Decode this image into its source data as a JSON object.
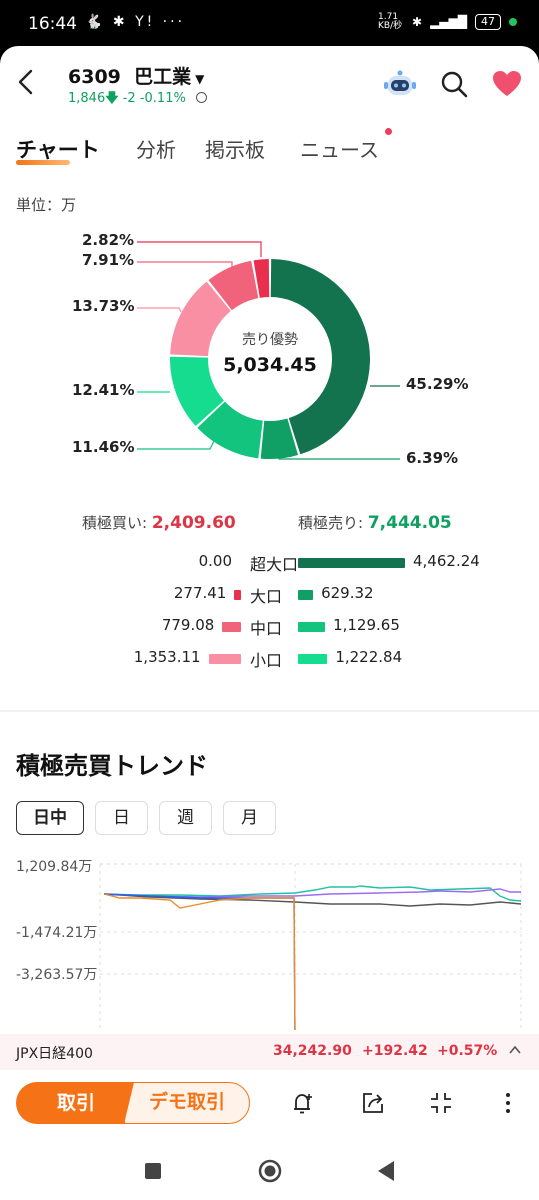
{
  "status": {
    "time": "16:44",
    "left_icons": "🐇 ✱ Y! ···",
    "speed": "1.71 KB/秒",
    "battery": "47"
  },
  "header": {
    "code": "6309",
    "name": "巴工業",
    "price": "1,846",
    "change": "-2 -0.11%"
  },
  "tabs": [
    "チャート",
    "分析",
    "掲示板",
    "ニュース"
  ],
  "unit_label": "単位：万",
  "donut": {
    "center_label": "売り優勢",
    "center_value": "5,034.45",
    "labels": {
      "p1": "2.82%",
      "p2": "7.91%",
      "p3": "13.73%",
      "p4": "12.41%",
      "p5": "11.46%",
      "p6": "45.29%",
      "p7": "6.39%"
    },
    "colors": {
      "superlarge_sell": "#14734f",
      "large_sell": "#10a065",
      "mid_sell": "#12c47e",
      "small_sell": "#16dc90",
      "small_buy": "#f88fa2",
      "mid_buy": "#f0637a",
      "large_buy": "#e8304e"
    }
  },
  "summary": {
    "buy_label": "積極買い:",
    "buy_value": "2,409.60",
    "sell_label": "積極売り:",
    "sell_value": "7,444.05"
  },
  "flow": [
    {
      "category": "超大口",
      "buy": "0.00",
      "sell": "4,462.24",
      "buy_amount": 0.0,
      "sell_amount": 4462.24
    },
    {
      "category": "大口",
      "buy": "277.41",
      "sell": "629.32",
      "buy_amount": 277.41,
      "sell_amount": 629.32
    },
    {
      "category": "中口",
      "buy": "779.08",
      "sell": "1,129.65",
      "buy_amount": 779.08,
      "sell_amount": 1129.65
    },
    {
      "category": "小口",
      "buy": "1,353.11",
      "sell": "1,222.84",
      "buy_amount": 1353.11,
      "sell_amount": 1222.84
    }
  ],
  "trend": {
    "title": "積極売買トレンド",
    "periods": [
      "日中",
      "日",
      "週",
      "月"
    ],
    "active_period": "日中",
    "y_labels": [
      "1,209.84万",
      "-1,474.21万",
      "-3,263.57万"
    ]
  },
  "ticker": {
    "name": "JPX日経400",
    "value": "34,242.90",
    "change": "+192.42",
    "pct": "+0.57%"
  },
  "bottom": {
    "trade": "取引",
    "demo_trade": "デモ取引"
  }
}
